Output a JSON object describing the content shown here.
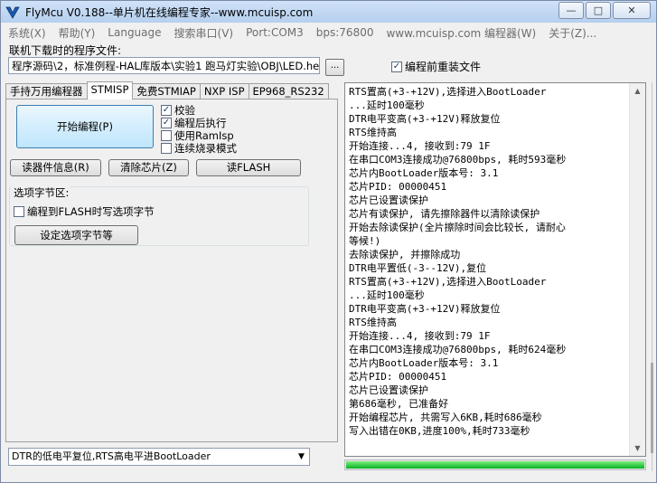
{
  "app": {
    "title": "FlyMcu V0.188--单片机在线编程专家--www.mcuisp.com"
  },
  "window_buttons": {
    "minimize": "—",
    "maximize": "□",
    "close": "✕"
  },
  "menu": [
    "系统(X)",
    "帮助(Y)",
    "Language",
    "搜索串口(V)",
    "Port:COM3",
    "bps:76800",
    "www.mcuisp.com 编程器(W)",
    "关于(Z)..."
  ],
  "file": {
    "label": "联机下载时的程序文件:",
    "path": "程序源码\\2，标准例程-HAL库版本\\实验1 跑马灯实验\\OBJ\\LED.hex",
    "browse_label": "...",
    "reload_label": "编程前重装文件",
    "reload_checked": true
  },
  "tabs": [
    "手持万用编程器",
    "STMISP",
    "免费STMIAP",
    "NXP ISP",
    "EP968_RS232"
  ],
  "active_tab": 1,
  "stmisp": {
    "start_button": "开始编程(P)",
    "options": [
      {
        "label": "校验",
        "checked": true
      },
      {
        "label": "编程后执行",
        "checked": true
      },
      {
        "label": "使用RamIsp",
        "checked": false
      },
      {
        "label": "连续烧录模式",
        "checked": false
      }
    ],
    "read_info_button": "读器件信息(R)",
    "erase_button": "清除芯片(Z)",
    "read_flash_button": "读FLASH",
    "option_bytes_title": "选项字节区:",
    "write_option_label": "编程到FLASH时写选项字节",
    "write_option_checked": false,
    "set_option_button": "设定选项字节等"
  },
  "dtr_select": {
    "value": "DTR的低电平复位,RTS高电平进BootLoader"
  },
  "log": {
    "lines": [
      "RTS置高(+3-+12V),选择进入BootLoader",
      "...延时100毫秒",
      "DTR电平变高(+3-+12V)释放复位",
      "RTS维持高",
      "开始连接...4, 接收到:79 1F",
      "在串口COM3连接成功@76800bps, 耗时593毫秒",
      "芯片内BootLoader版本号: 3.1",
      "芯片PID: 00000451",
      "芯片已设置读保护",
      "芯片有读保护, 请先擦除器件以清除读保护",
      "开始去除读保护(全片擦除时间会比较长, 请耐心",
      "等候!)",
      "去除读保护, 并擦除成功",
      "DTR电平置低(-3--12V),复位",
      "RTS置高(+3-+12V),选择进入BootLoader",
      "...延时100毫秒",
      "DTR电平变高(+3-+12V)释放复位",
      "RTS维持高",
      "开始连接...4, 接收到:79 1F",
      "在串口COM3连接成功@76800bps, 耗时624毫秒",
      "芯片内BootLoader版本号: 3.1",
      "芯片PID: 00000451",
      "芯片已设置读保护",
      "第686毫秒, 已准备好",
      "开始编程芯片, 共需写入6KB,耗时686毫秒",
      "写入出错在0KB,进度100%,耗时733毫秒"
    ]
  },
  "progress": {
    "percent": 100
  },
  "colors": {
    "progress": "#06b025",
    "title_bar": "#c4dbf5",
    "start_button": "#bee6fd"
  }
}
